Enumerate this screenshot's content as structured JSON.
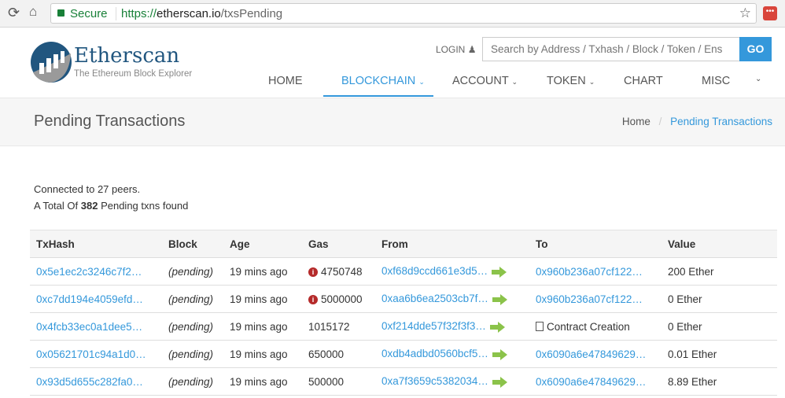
{
  "browser": {
    "secure_label": "Secure",
    "url_scheme": "https://",
    "url_host": "etherscan.io",
    "url_path": "/txsPending"
  },
  "header": {
    "logo_title": "Etherscan",
    "logo_subtitle": "The Ethereum Block Explorer",
    "login": "LOGIN",
    "search_placeholder": "Search by Address / Txhash / Block / Token / Ens",
    "go": "GO"
  },
  "nav": {
    "home": "HOME",
    "blockchain": "BLOCKCHAIN",
    "account": "ACCOUNT",
    "token": "TOKEN",
    "chart": "CHART",
    "misc": "MISC"
  },
  "page": {
    "title": "Pending Transactions",
    "breadcrumb_home": "Home",
    "breadcrumb_sep": "/",
    "breadcrumb_current": "Pending Transactions"
  },
  "summary": {
    "connected": "Connected to 27 peers.",
    "total_prefix": "A Total Of ",
    "total_count": "382",
    "total_suffix": " Pending txns found"
  },
  "table": {
    "headers": [
      "TxHash",
      "Block",
      "Age",
      "Gas",
      "From",
      "To",
      "Value"
    ],
    "rows": [
      {
        "hash": "0x5e1ec2c3246c7f2…",
        "block": "(pending)",
        "age": "19 mins ago",
        "gas": "4750748",
        "gas_warn": true,
        "from": "0xf68d9ccd661e3d5…",
        "to": "0x960b236a07cf122…",
        "value": "200 Ether"
      },
      {
        "hash": "0xc7dd194e4059efd…",
        "block": "(pending)",
        "age": "19 mins ago",
        "gas": "5000000",
        "gas_warn": true,
        "from": "0xaa6b6ea2503cb7f…",
        "to": "0x960b236a07cf122…",
        "value": "0 Ether"
      },
      {
        "hash": "0x4fcb33ec0a1dee5…",
        "block": "(pending)",
        "age": "19 mins ago",
        "gas": "1015172",
        "gas_warn": false,
        "from": "0xf214dde57f32f3f3…",
        "to": "Contract Creation",
        "value": "0 Ether"
      },
      {
        "hash": "0x05621701c94a1d0…",
        "block": "(pending)",
        "age": "19 mins ago",
        "gas": "650000",
        "gas_warn": false,
        "from": "0xdb4adbd0560bcf5…",
        "to": "0x6090a6e47849629…",
        "value": "0.01 Ether"
      },
      {
        "hash": "0x93d5d655c282fa0…",
        "block": "(pending)",
        "age": "19 mins ago",
        "gas": "500000",
        "gas_warn": false,
        "from": "0xa7f3659c5382034…",
        "to": "0x6090a6e47849629…",
        "value": "8.89 Ether"
      }
    ]
  },
  "colors": {
    "link": "#3498db",
    "brand": "#21325b",
    "secure": "#188038",
    "warn": "#b52a2a",
    "arrow": "#8bc34a"
  }
}
